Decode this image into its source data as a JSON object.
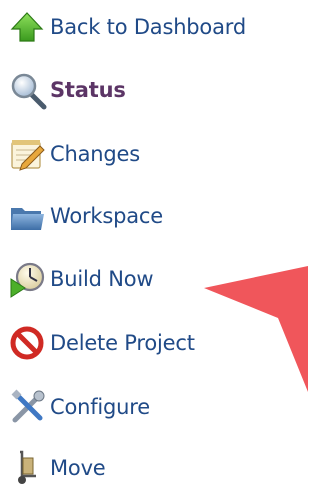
{
  "menu": {
    "items": [
      {
        "label": "Back to Dashboard",
        "icon": "up-arrow-icon"
      },
      {
        "label": "Status",
        "icon": "magnifier-icon"
      },
      {
        "label": "Changes",
        "icon": "notepad-icon"
      },
      {
        "label": "Workspace",
        "icon": "folder-icon"
      },
      {
        "label": "Build Now",
        "icon": "clock-play-icon"
      },
      {
        "label": "Delete Project",
        "icon": "no-entry-icon"
      },
      {
        "label": "Configure",
        "icon": "tools-icon"
      },
      {
        "label": "Move",
        "icon": "hand-truck-icon"
      }
    ]
  },
  "colors": {
    "link": "#204a87",
    "link_active": "#5c3566",
    "callout": "#f0565b"
  }
}
